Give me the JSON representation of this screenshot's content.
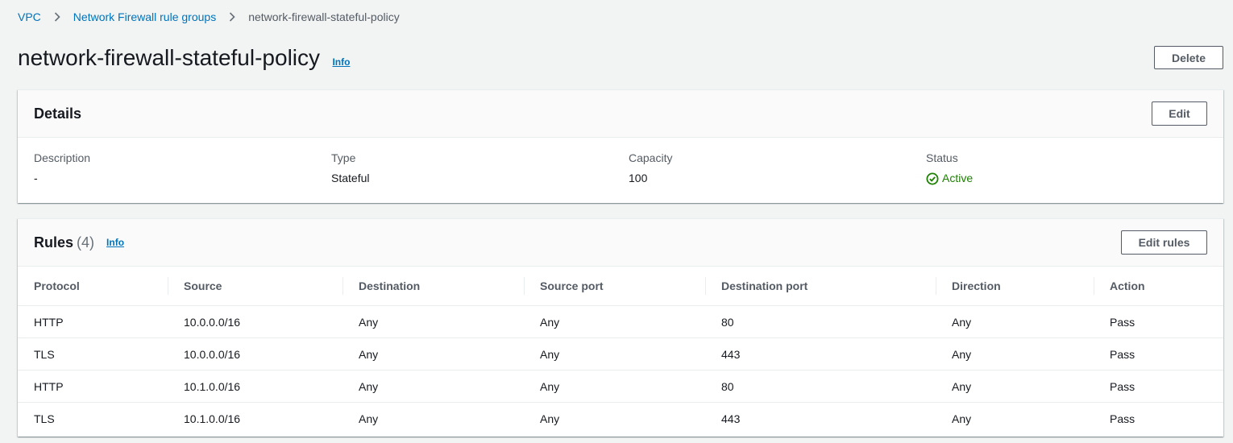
{
  "breadcrumb": {
    "items": [
      "VPC",
      "Network Firewall rule groups"
    ],
    "current": "network-firewall-stateful-policy"
  },
  "header": {
    "title": "network-firewall-stateful-policy",
    "info": "Info",
    "delete_label": "Delete"
  },
  "details": {
    "title": "Details",
    "edit_label": "Edit",
    "fields": [
      {
        "label": "Description",
        "value": "-"
      },
      {
        "label": "Type",
        "value": "Stateful"
      },
      {
        "label": "Capacity",
        "value": "100"
      },
      {
        "label": "Status",
        "value": "Active"
      }
    ],
    "status_color": "#1d8102"
  },
  "rules": {
    "title": "Rules",
    "count": "(4)",
    "info": "Info",
    "edit_label": "Edit rules",
    "columns": [
      "Protocol",
      "Source",
      "Destination",
      "Source port",
      "Destination port",
      "Direction",
      "Action"
    ],
    "rows": [
      [
        "HTTP",
        "10.0.0.0/16",
        "Any",
        "Any",
        "80",
        "Any",
        "Pass"
      ],
      [
        "TLS",
        "10.0.0.0/16",
        "Any",
        "Any",
        "443",
        "Any",
        "Pass"
      ],
      [
        "HTTP",
        "10.1.0.0/16",
        "Any",
        "Any",
        "80",
        "Any",
        "Pass"
      ],
      [
        "TLS",
        "10.1.0.0/16",
        "Any",
        "Any",
        "443",
        "Any",
        "Pass"
      ]
    ]
  },
  "colors": {
    "link": "#0073bb",
    "background": "#f2f3f3"
  }
}
